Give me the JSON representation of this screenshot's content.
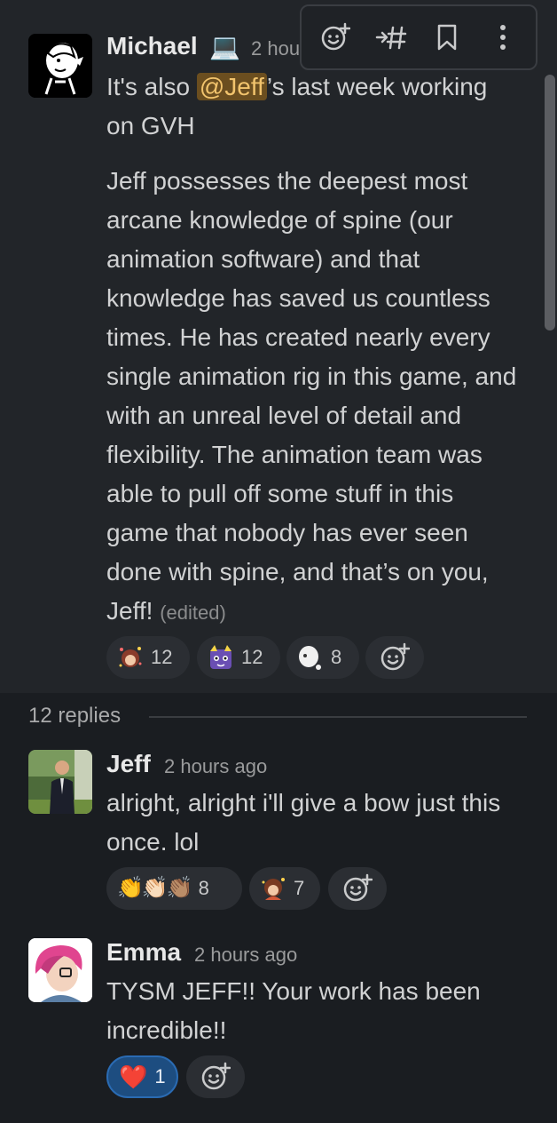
{
  "parent": {
    "author": "Michael",
    "status_emoji": "💻",
    "time": "2 hou",
    "line1_pre": "It's also ",
    "mention": "@Jeff",
    "line1_post": "’s last week working",
    "line2": "on GVH",
    "body_lines": [
      "Jeff possesses the deepest most",
      "arcane knowledge of spine (our",
      "animation software) and that",
      "knowledge has saved us countless",
      "times. He has created nearly every",
      "single animation rig in this game, and",
      "with an unreal level of detail and",
      "flexibility. The animation team was",
      "able to pull off some stuff in this",
      "game that nobody has ever seen",
      "done with spine, and that’s on you,"
    ],
    "last_line": "Jeff!",
    "edited": "(edited)",
    "reactions": [
      {
        "emoji": "custom-girl-sparkle",
        "count": "12"
      },
      {
        "emoji": "custom-purple-cat",
        "count": "12"
      },
      {
        "emoji": "custom-ghost-blob",
        "count": "8"
      }
    ]
  },
  "toolbar": {
    "icons": [
      "add-reaction-icon",
      "forward-to-channel-icon",
      "bookmark-icon",
      "more-actions-icon"
    ]
  },
  "thread": {
    "replies_label": "12 replies"
  },
  "replies": [
    {
      "author": "Jeff",
      "time": "2 hours ago",
      "lines": [
        "alright, alright i'll give a bow just this",
        "once. lol"
      ],
      "reactions": [
        {
          "emoji": "👏👏🏻👏🏽",
          "count": "8"
        },
        {
          "emoji": "custom-bow-girl",
          "count": "7"
        }
      ]
    },
    {
      "author": "Emma",
      "time": "2 hours ago",
      "lines": [
        "TYSM JEFF!! Your work has been",
        "incredible!!"
      ],
      "reactions": [
        {
          "emoji": "❤️",
          "count": "1"
        }
      ]
    }
  ],
  "colors": {
    "background": "#1a1d21",
    "parent_bg": "#222529",
    "mention_bg": "#6b4e1f",
    "mention_text": "#f2c46d",
    "active_reaction": "#1d4d80"
  }
}
